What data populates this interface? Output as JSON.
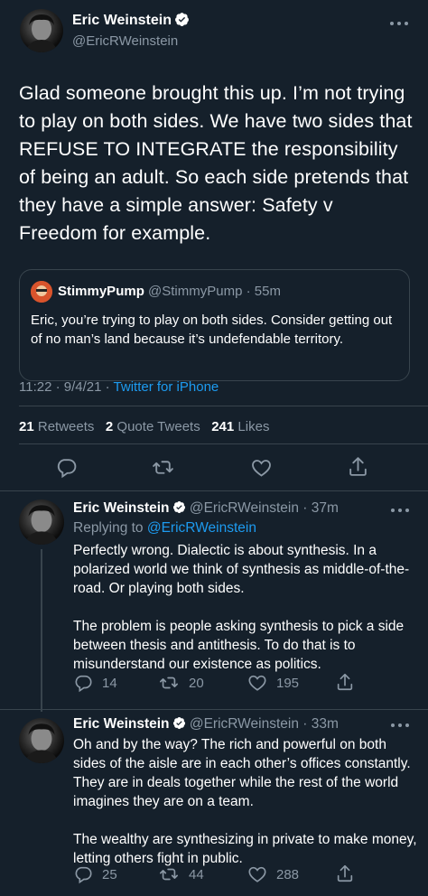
{
  "main_tweet": {
    "author_name": "Eric Weinstein",
    "handle": "@EricRWeinstein",
    "text": "Glad someone brought this up. I’m not trying to play on both sides. We have two sides that REFUSE TO INTEGRATE the responsibility of being an adult. So each side pretends that they have a simple answer: Safety v Freedom for example.",
    "quote": {
      "author_name": "StimmyPump",
      "handle": "@StimmyPump",
      "time": "· 55m",
      "text": "Eric, you’re trying to play on both sides. Consider getting out of no man’s land because it’s undefendable territory."
    },
    "timestamp": "11:22 · 9/4/21 ·",
    "source": "Twitter for iPhone",
    "stats": {
      "retweets_count": "21",
      "retweets_label": "Retweets",
      "quotes_count": "2",
      "quotes_label": "Quote Tweets",
      "likes_count": "241",
      "likes_label": "Likes"
    }
  },
  "replies": [
    {
      "author_name": "Eric Weinstein",
      "handle": "@EricRWeinstein",
      "time": "· 37m",
      "replying_prefix": "Replying to",
      "replying_to": "@EricRWeinstein",
      "paragraph_1": "Perfectly wrong. Dialectic is about synthesis. In a polarized world we think of synthesis as middle-of-the-road. Or playing both sides.",
      "paragraph_2": "The problem is people asking synthesis to pick a side between thesis and antithesis. To do that is to misunderstand our existence as politics.",
      "reply_count": "14",
      "retweet_count": "20",
      "like_count": "195"
    },
    {
      "author_name": "Eric Weinstein",
      "handle": "@EricRWeinstein",
      "time": "· 33m",
      "paragraph_1": "Oh and by the way? The rich and powerful on both sides of the aisle are in each other’s offices constantly. They are in deals together while the rest of the world imagines they are on a team.",
      "paragraph_2": "The wealthy are synthesizing in private to make money, letting others fight in public.",
      "reply_count": "25",
      "retweet_count": "44",
      "like_count": "288"
    }
  ],
  "icons": {
    "reply": "reply-icon",
    "retweet": "retweet-icon",
    "like": "heart-icon",
    "share": "share-icon",
    "verified": "verified-badge-icon",
    "more": "more-options-icon"
  },
  "colors": {
    "background": "#15202b",
    "accent": "#1d9bf0",
    "muted": "#8b98a5",
    "divider": "#38444d"
  }
}
